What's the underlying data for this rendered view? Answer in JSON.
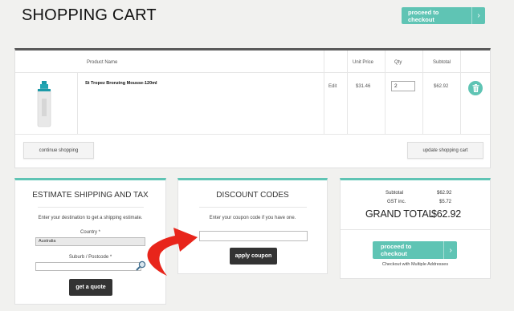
{
  "header": {
    "title": "SHOPPING CART",
    "checkout_label": "proceed to checkout"
  },
  "cart": {
    "columns": [
      "Product Name",
      "Unit Price",
      "Qty",
      "Subtotal"
    ],
    "item": {
      "name": "St Tropez Bronzing Mousse-120ml",
      "edit_label": "Edit",
      "unit_price": "$31.46",
      "qty": "2",
      "subtotal": "$62.92"
    },
    "continue_label": "continue shopping",
    "update_label": "update shopping cart"
  },
  "shipping": {
    "title": "ESTIMATE SHIPPING AND TAX",
    "intro": "Enter your destination to get a shipping estimate.",
    "country_label": "Country *",
    "country_value": "Australia",
    "suburb_label": "Suburb / Postcode *",
    "suburb_value": "",
    "quote_label": "get a quote"
  },
  "discount": {
    "title": "DISCOUNT CODES",
    "intro": "Enter your coupon code if you have one.",
    "coupon_value": "",
    "apply_label": "apply coupon"
  },
  "totals": {
    "subtotal_label": "Subtotal",
    "subtotal_value": "$62.92",
    "gst_label": "GST inc.",
    "gst_value": "$5.72",
    "grand_label": "GRAND TOTAL",
    "grand_value": "$62.92",
    "checkout_label": "proceed to checkout",
    "multi_label": "Checkout with Multiple Addresses"
  },
  "icons": {
    "cart_chevron": "chevron-right-icon",
    "trash": "trash-icon",
    "search": "magnifier-icon",
    "arrow": "curved-arrow-icon"
  },
  "colors": {
    "accent": "#5fc4b4",
    "dark_button": "#333333",
    "arrow": "#e8251b"
  }
}
